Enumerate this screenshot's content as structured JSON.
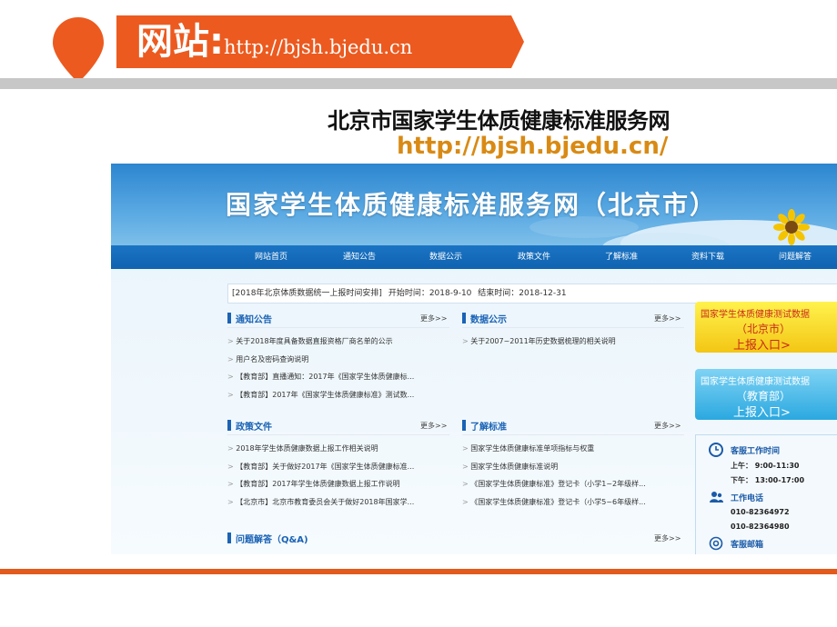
{
  "slide": {
    "ribbon_label": "网站:",
    "ribbon_url": "http://bjsh.bjedu.cn",
    "heading": "北京市国家学生体质健康标准服务网",
    "url": "http://bjsh.bjedu.cn/",
    "colors": {
      "accent": "#e25a1c",
      "gray_bar": "#c7c7c7",
      "url_color": "#d98a14"
    }
  },
  "site": {
    "banner_title": "国家学生体质健康标准服务网（北京市）",
    "nav": [
      "网站首页",
      "通知公告",
      "数据公示",
      "政策文件",
      "了解标准",
      "资料下载",
      "问题解答"
    ],
    "notice": {
      "title": "[2018年北京体质数据统一上报时间安排]",
      "start_label": "开始时间：",
      "start": "2018-9-10",
      "end_label": "结束时间：",
      "end": "2018-12-31"
    },
    "more_label": "更多>>",
    "sections": {
      "tongzhi": {
        "title": "通知公告",
        "items": [
          "关于2018年度具备数据直报资格厂商名单的公示",
          "用户名及密码查询说明",
          "【教育部】直播通知：2017年《国家学生体质健康标...",
          "【教育部】2017年《国家学生体质健康标准》测试数..."
        ]
      },
      "shuju": {
        "title": "数据公示",
        "items": [
          "关于2007~2011年历史数据梳理的相关说明"
        ]
      },
      "zhengce": {
        "title": "政策文件",
        "items": [
          "2018年学生体质健康数据上报工作相关说明",
          "【教育部】关于做好2017年《国家学生体质健康标准...",
          "【教育部】2017年学生体质健康数据上报工作说明",
          "【北京市】北京市教育委员会关于做好2018年国家学..."
        ]
      },
      "liaojie": {
        "title": "了解标准",
        "items": [
          "国家学生体质健康标准单项指标与权重",
          "国家学生体质健康标准说明",
          "《国家学生体质健康标准》登记卡（小学1~2年级样...",
          "《国家学生体质健康标准》登记卡（小学5~6年级样..."
        ]
      },
      "wenti": {
        "title": "问题解答（Q&A)"
      }
    },
    "report_bj": {
      "line1": "国家学生体质健康测试数据",
      "line2": "（北京市）",
      "line3": "上报入口>"
    },
    "report_moe": {
      "line1": "国家学生体质健康测试数据",
      "line2": "（教育部）",
      "line3": "上报入口>"
    },
    "service": {
      "work_time_title": "客服工作时间",
      "am": "上午：  9:00-11:30",
      "pm": "下午：  13:00-17:00",
      "phone_title": "工作电话",
      "phone1": "010-82364972",
      "phone2": "010-82364980",
      "email_title": "客服邮箱"
    }
  }
}
